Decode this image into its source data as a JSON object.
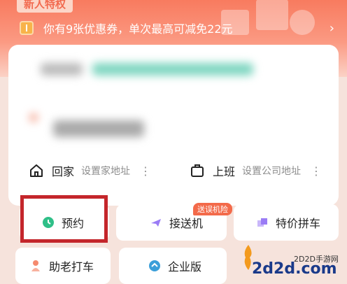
{
  "banner": {
    "badge": "新人特权",
    "coupon_text": "你有9张优惠券，单次最高可减免22元",
    "arrow": "›"
  },
  "shortcuts": {
    "home": {
      "label": "回家",
      "sub": "设置家地址",
      "dots": "⋮"
    },
    "work": {
      "label": "上班",
      "sub": "设置公司地址",
      "dots": "⋮"
    }
  },
  "tiles": [
    {
      "label": "预约",
      "icon": "clock-icon"
    },
    {
      "label": "接送机",
      "icon": "plane-icon",
      "tag": "送误机险"
    },
    {
      "label": "特价拼车",
      "icon": "carpool-icon"
    },
    {
      "label": "助老打车",
      "icon": "elder-icon"
    },
    {
      "label": "企业版",
      "icon": "enterprise-icon"
    }
  ],
  "watermark": {
    "text": "2D2D手游网",
    "logo": "2d2d.com"
  },
  "colors": {
    "accent": "#f26a4f",
    "highlight_box": "#c4262b"
  }
}
